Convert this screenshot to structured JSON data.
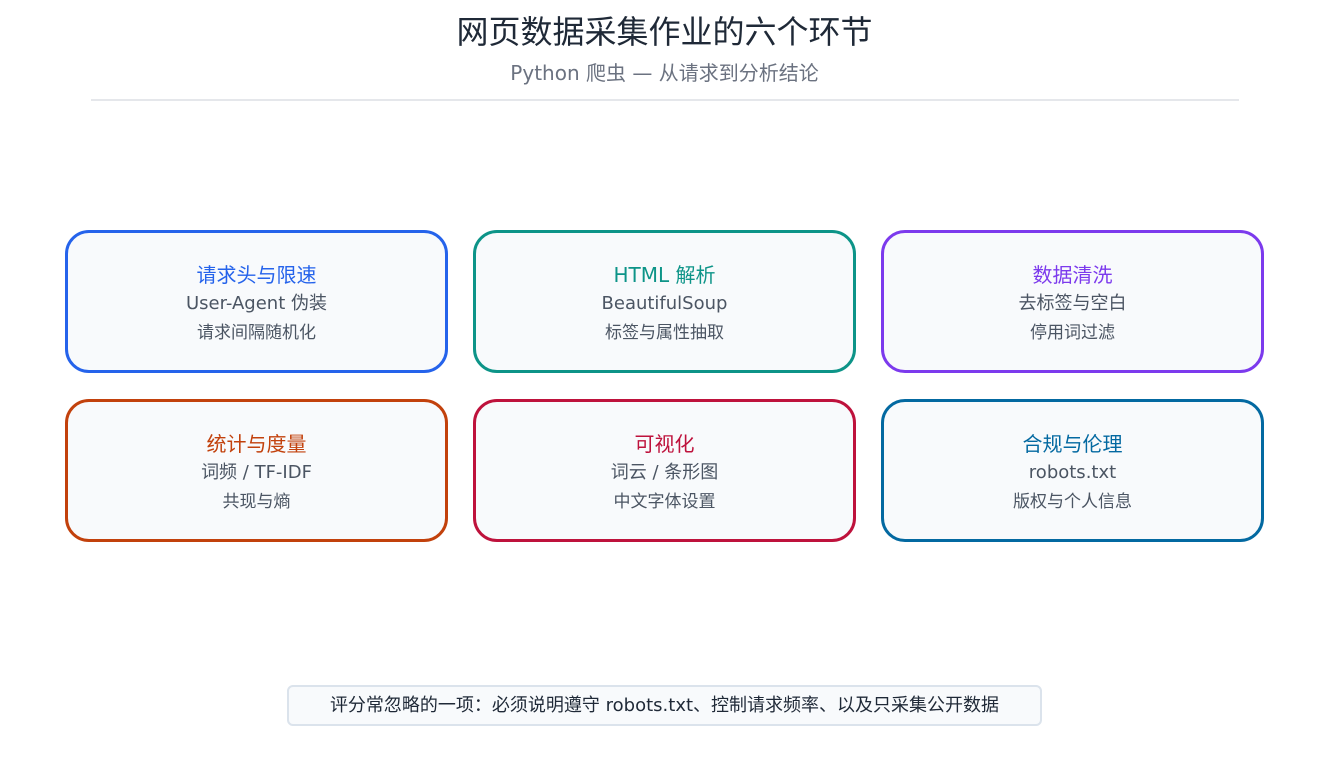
{
  "header": {
    "title": "网页数据采集作业的六个环节",
    "subtitle": "Python 爬虫 — 从请求到分析结论"
  },
  "cards": [
    {
      "title": "请求头与限速",
      "line1": "User-Agent 伪装",
      "line2": "请求间隔随机化",
      "color": "#2563eb"
    },
    {
      "title": "HTML 解析",
      "line1": "BeautifulSoup",
      "line2": "标签与属性抽取",
      "color": "#0d9488"
    },
    {
      "title": "数据清洗",
      "line1": "去标签与空白",
      "line2": "停用词过滤",
      "color": "#7c3aed"
    },
    {
      "title": "统计与度量",
      "line1": "词频 / TF-IDF",
      "line2": "共现与熵",
      "color": "#c2410c"
    },
    {
      "title": "可视化",
      "line1": "词云 / 条形图",
      "line2": "中文字体设置",
      "color": "#be123c"
    },
    {
      "title": "合规与伦理",
      "line1": "robots.txt",
      "line2": "版权与个人信息",
      "color": "#0369a1"
    }
  ],
  "note": {
    "text": "评分常忽略的一项：必须说明遵守 robots.txt、控制请求频率、以及只采集公开数据"
  }
}
